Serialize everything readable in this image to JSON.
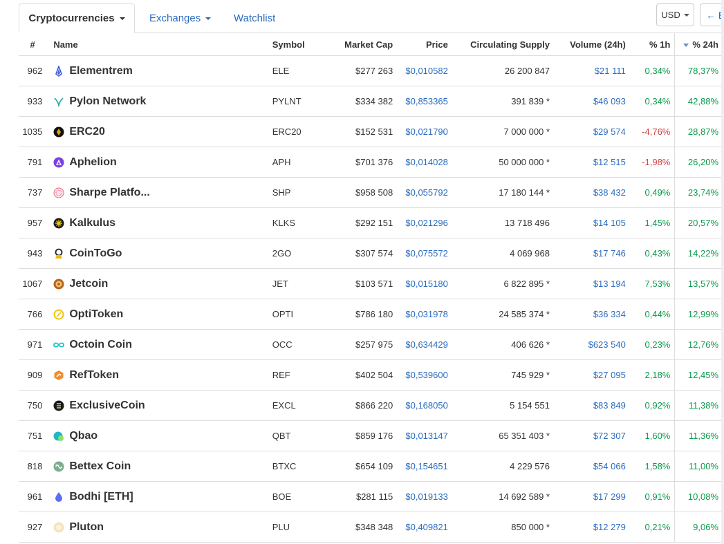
{
  "tabs": {
    "cryptocurrencies": "Cryptocurrencies",
    "exchanges": "Exchanges",
    "watchlist": "Watchlist"
  },
  "currency": "USD",
  "back_label": "← B",
  "headers": {
    "rank": "#",
    "name": "Name",
    "symbol": "Symbol",
    "market_cap": "Market Cap",
    "price": "Price",
    "supply": "Circulating Supply",
    "volume": "Volume (24h)",
    "h1": "% 1h",
    "h24": "% 24h"
  },
  "colors": {
    "link": "#2a6cbf",
    "positive": "#0a9a4a",
    "negative": "#d23e3e"
  },
  "rows": [
    {
      "rank": "962",
      "name": "Elementrem",
      "symbol": "ELE",
      "market_cap": "$277 263",
      "price": "$0,010582",
      "supply": "26 200 847",
      "volume": "$21 111",
      "h1": "0,34%",
      "h24": "78,37%",
      "h1_dir": "pos",
      "icon": "elementrem-icon",
      "icon_color": "#3b5bdb"
    },
    {
      "rank": "933",
      "name": "Pylon Network",
      "symbol": "PYLNT",
      "market_cap": "$334 382",
      "price": "$0,853365",
      "supply": "391 839 *",
      "volume": "$46 093",
      "h1": "0,34%",
      "h24": "42,88%",
      "h1_dir": "pos",
      "icon": "pylon-network-icon",
      "icon_color": "#3aa9a9"
    },
    {
      "rank": "1035",
      "name": "ERC20",
      "symbol": "ERC20",
      "market_cap": "$152 531",
      "price": "$0,021790",
      "supply": "7 000 000 *",
      "volume": "$29 574",
      "h1": "-4,76%",
      "h24": "28,87%",
      "h1_dir": "neg",
      "icon": "erc20-icon",
      "icon_color": "#111111"
    },
    {
      "rank": "791",
      "name": "Aphelion",
      "symbol": "APH",
      "market_cap": "$701 376",
      "price": "$0,014028",
      "supply": "50 000 000 *",
      "volume": "$12 515",
      "h1": "-1,98%",
      "h24": "26,20%",
      "h1_dir": "neg",
      "icon": "aphelion-icon",
      "icon_color": "#7b3fe4"
    },
    {
      "rank": "737",
      "name": "Sharpe Platfo...",
      "symbol": "SHP",
      "market_cap": "$958 508",
      "price": "$0,055792",
      "supply": "17 180 144 *",
      "volume": "$38 432",
      "h1": "0,49%",
      "h24": "23,74%",
      "h1_dir": "pos",
      "icon": "sharpe-platform-icon",
      "icon_color": "#e86a8a"
    },
    {
      "rank": "957",
      "name": "Kalkulus",
      "symbol": "KLKS",
      "market_cap": "$292 151",
      "price": "$0,021296",
      "supply": "13 718 496",
      "volume": "$14 105",
      "h1": "1,45%",
      "h24": "20,57%",
      "h1_dir": "pos",
      "icon": "kalkulus-icon",
      "icon_color": "#1a1a1a"
    },
    {
      "rank": "943",
      "name": "CoinToGo",
      "symbol": "2GO",
      "market_cap": "$307 574",
      "price": "$0,075572",
      "supply": "4 069 968",
      "volume": "$17 746",
      "h1": "0,43%",
      "h24": "14,22%",
      "h1_dir": "pos",
      "icon": "cointogo-icon",
      "icon_color": "#222222"
    },
    {
      "rank": "1067",
      "name": "Jetcoin",
      "symbol": "JET",
      "market_cap": "$103 571",
      "price": "$0,015180",
      "supply": "6 822 895 *",
      "volume": "$13 194",
      "h1": "7,53%",
      "h24": "13,57%",
      "h1_dir": "pos",
      "icon": "jetcoin-icon",
      "icon_color": "#b5651d"
    },
    {
      "rank": "766",
      "name": "OptiToken",
      "symbol": "OPTI",
      "market_cap": "$786 180",
      "price": "$0,031978",
      "supply": "24 585 374 *",
      "volume": "$36 334",
      "h1": "0,44%",
      "h24": "12,99%",
      "h1_dir": "pos",
      "icon": "optitoken-icon",
      "icon_color": "#f2c500"
    },
    {
      "rank": "971",
      "name": "Octoin Coin",
      "symbol": "OCC",
      "market_cap": "$257 975",
      "price": "$0,634429",
      "supply": "406 626 *",
      "volume": "$623 540",
      "h1": "0,23%",
      "h24": "12,76%",
      "h1_dir": "pos",
      "icon": "octoin-coin-icon",
      "icon_color": "#19c6c6"
    },
    {
      "rank": "909",
      "name": "RefToken",
      "symbol": "REF",
      "market_cap": "$402 504",
      "price": "$0,539600",
      "supply": "745 929 *",
      "volume": "$27 095",
      "h1": "2,18%",
      "h24": "12,45%",
      "h1_dir": "pos",
      "icon": "reftoken-icon",
      "icon_color": "#f28c28"
    },
    {
      "rank": "750",
      "name": "ExclusiveCoin",
      "symbol": "EXCL",
      "market_cap": "$866 220",
      "price": "$0,168050",
      "supply": "5 154 551",
      "volume": "$83 849",
      "h1": "0,92%",
      "h24": "11,38%",
      "h1_dir": "pos",
      "icon": "exclusivecoin-icon",
      "icon_color": "#1a1a1a"
    },
    {
      "rank": "751",
      "name": "Qbao",
      "symbol": "QBT",
      "market_cap": "$859 176",
      "price": "$0,013147",
      "supply": "65 351 403 *",
      "volume": "$72 307",
      "h1": "1,60%",
      "h24": "11,36%",
      "h1_dir": "pos",
      "icon": "qbao-icon",
      "icon_color": "#20b7c9"
    },
    {
      "rank": "818",
      "name": "Bettex Coin",
      "symbol": "BTXC",
      "market_cap": "$654 109",
      "price": "$0,154651",
      "supply": "4 229 576",
      "volume": "$54 066",
      "h1": "1,58%",
      "h24": "11,00%",
      "h1_dir": "pos",
      "icon": "bettex-coin-icon",
      "icon_color": "#7cae8c"
    },
    {
      "rank": "961",
      "name": "Bodhi [ETH]",
      "symbol": "BOE",
      "market_cap": "$281 115",
      "price": "$0,019133",
      "supply": "14 692 589 *",
      "volume": "$17 299",
      "h1": "0,91%",
      "h24": "10,08%",
      "h1_dir": "pos",
      "icon": "bodhi-icon",
      "icon_color": "#5b6ef0"
    },
    {
      "rank": "927",
      "name": "Pluton",
      "symbol": "PLU",
      "market_cap": "$348 348",
      "price": "$0,409821",
      "supply": "850 000 *",
      "volume": "$12 279",
      "h1": "0,21%",
      "h24": "9,06%",
      "h1_dir": "pos",
      "icon": "pluton-icon",
      "icon_color": "#f3e4c0"
    }
  ]
}
